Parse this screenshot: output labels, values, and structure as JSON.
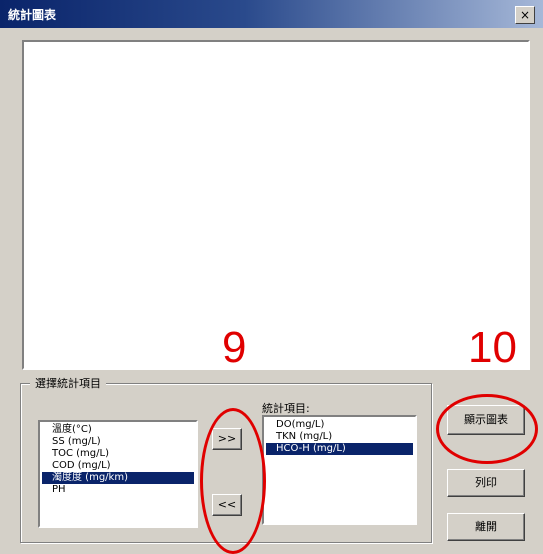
{
  "window": {
    "title": "統計圖表",
    "close_glyph": "×"
  },
  "group": {
    "label": "選擇統計項目"
  },
  "available_items": [
    "溫度(°C)",
    "SS (mg/L)",
    "TOC (mg/L)",
    "COD (mg/L)",
    "濁度度 (mg/km)",
    "PH"
  ],
  "available_selected_index": 4,
  "chosen_label": "統計項目:",
  "chosen_items": [
    "DO(mg/L)",
    "TKN (mg/L)",
    "HCO-H (mg/L)"
  ],
  "chosen_selected_index": 2,
  "buttons": {
    "add": ">>",
    "remove": "<<",
    "show_chart": "顯示圖表",
    "print": "列印",
    "exit": "離開"
  },
  "annotations": {
    "left_number": "9",
    "right_number": "10"
  },
  "colors": {
    "annotation": "#e00000",
    "selection": "#0a246a",
    "titlebar": "#0a246a"
  }
}
